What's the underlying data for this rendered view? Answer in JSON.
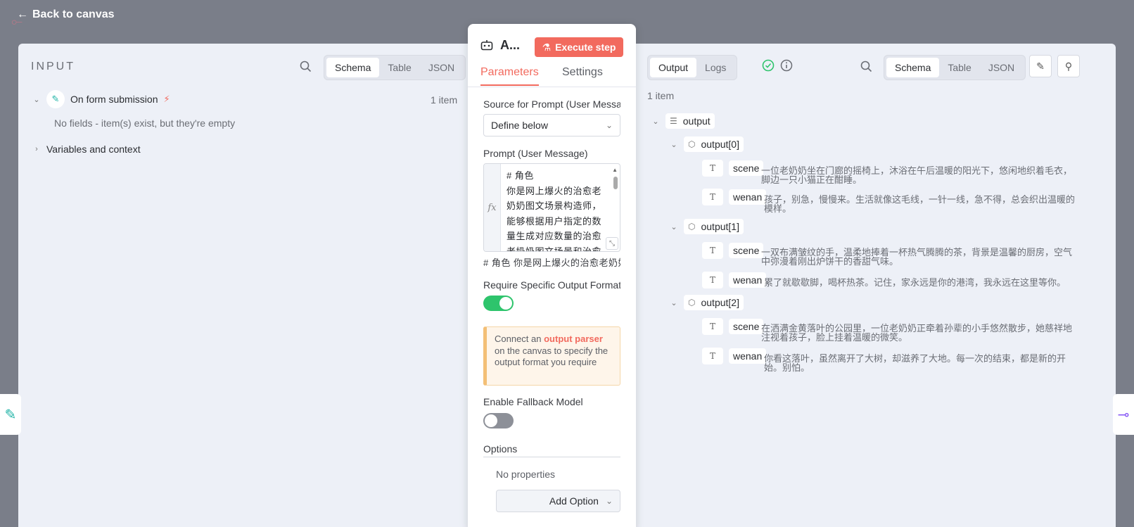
{
  "nav": {
    "back_label": "Back to canvas"
  },
  "input": {
    "title": "INPUT",
    "view_tabs": [
      "Schema",
      "Table",
      "JSON"
    ],
    "node": {
      "label": "On form submission",
      "count": "1 item",
      "empty_msg": "No fields - item(s) exist, but they're empty"
    },
    "variables_label": "Variables and context"
  },
  "node": {
    "name": "A...",
    "execute_label": "Execute step",
    "tabs": [
      "Parameters",
      "Settings"
    ],
    "source_label": "Source for Prompt (User Message)",
    "source_value": "Define below",
    "prompt_label": "Prompt (User Message)",
    "prompt_text": "# 角色\n你是网上爆火的治愈老奶奶图文场景构造师，能够根据用户指定的数量生成对应数量的治愈老奶奶图文场景和治愈",
    "prompt_preview": "#  角色  你是网上爆火的治愈老奶奶图文场景构造师，",
    "require_format_label": "Require Specific Output Format",
    "notice_pre": "Connect an ",
    "notice_link": "output parser",
    "notice_post": " on the canvas to specify the output format you require",
    "fallback_label": "Enable Fallback Model",
    "options_label": "Options",
    "no_properties": "No properties",
    "add_option_label": "Add Option"
  },
  "output": {
    "tabs": [
      "Output",
      "Logs"
    ],
    "view_tabs": [
      "Schema",
      "Table",
      "JSON"
    ],
    "count": "1 item",
    "root_label": "output",
    "items": [
      {
        "label": "output[0]",
        "scene_key": "scene",
        "scene": "一位老奶奶坐在门廊的摇椅上，沐浴在午后温暖的阳光下，悠闲地织着毛衣，脚边一只小猫正在酣睡。",
        "wenan_key": "wenan",
        "wenan": "孩子，别急，慢慢来。生活就像这毛线，一针一线，急不得，总会织出温暖的模样。"
      },
      {
        "label": "output[1]",
        "scene_key": "scene",
        "scene": "一双布满皱纹的手，温柔地捧着一杯热气腾腾的茶，背景是温馨的厨房，空气中弥漫着刚出炉饼干的香甜气味。",
        "wenan_key": "wenan",
        "wenan": "累了就歇歇脚，喝杯热茶。记住，家永远是你的港湾，我永远在这里等你。"
      },
      {
        "label": "output[2]",
        "scene_key": "scene",
        "scene": "在洒满金黄落叶的公园里，一位老奶奶正牵着孙辈的小手悠然散步，她慈祥地注视着孩子，脸上挂着温暖的微笑。",
        "wenan_key": "wenan",
        "wenan": "你看这落叶，虽然离开了大树，却滋养了大地。每一次的结束，都是新的开始。别怕。"
      }
    ]
  },
  "colors": {
    "accent": "#f26a5e",
    "toggle_on": "#2ec46c",
    "success": "#2ec46c"
  }
}
